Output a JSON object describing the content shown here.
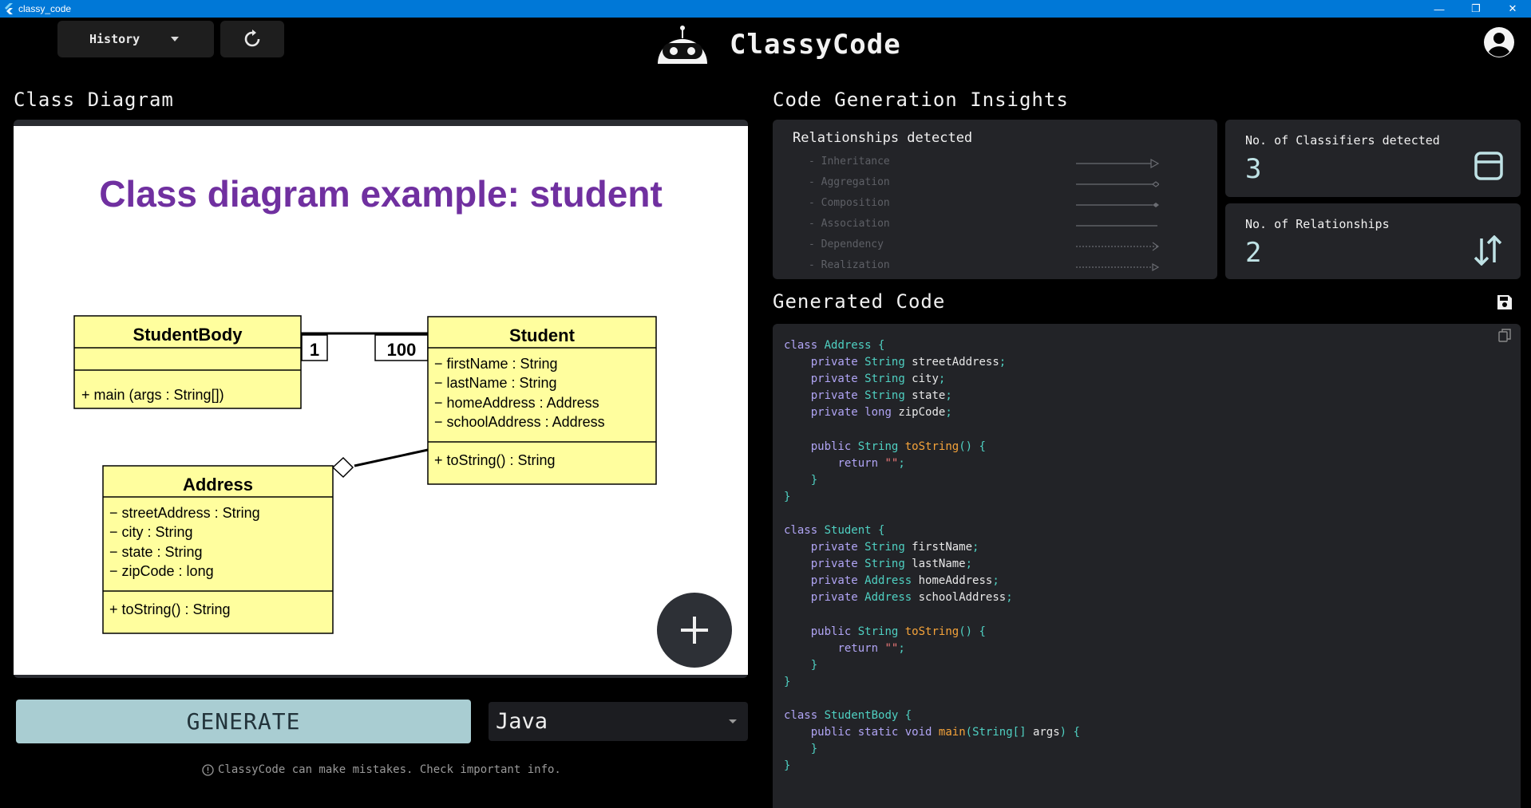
{
  "window": {
    "title": "classy_code"
  },
  "header": {
    "history_label": "History",
    "brand": "ClassyCode"
  },
  "diagram_section": {
    "title": "Class Diagram"
  },
  "diagram": {
    "heading": "Class diagram example: student",
    "classes": [
      {
        "name": "StudentBody",
        "attributes": [],
        "methods": [
          "+ main (args : String[])"
        ]
      },
      {
        "name": "Student",
        "attributes": [
          "− firstName : String",
          "− lastName : String",
          "− homeAddress : Address",
          "− schoolAddress : Address"
        ],
        "methods": [
          "+ toString() : String"
        ]
      },
      {
        "name": "Address",
        "attributes": [
          "− streetAddress : String",
          "− city : String",
          "− state : String",
          "− zipCode : long"
        ],
        "methods": [
          "+ toString() : String"
        ]
      }
    ],
    "multiplicities": [
      "1",
      "100"
    ]
  },
  "controls": {
    "generate_label": "GENERATE",
    "language": "Java",
    "disclaimer": "ClassyCode can make mistakes. Check important info."
  },
  "insights": {
    "title": "Code Generation Insights",
    "relationships_title": "Relationships detected",
    "relationship_types": [
      "- Inheritance",
      "- Aggregation",
      "- Composition",
      "- Association",
      "- Dependency",
      "- Realization"
    ],
    "classifiers_label": "No. of Classifiers detected",
    "classifiers_value": "3",
    "relationships_label": "No. of Relationships",
    "relationships_value": "2"
  },
  "generated_code": {
    "title": "Generated Code",
    "language": "Java",
    "lines": [
      "class Address {",
      "    private String streetAddress;",
      "    private String city;",
      "    private String state;",
      "    private long zipCode;",
      "",
      "    public String toString() {",
      "        return \"\";",
      "    }",
      "}",
      "",
      "class Student {",
      "    private String firstName;",
      "    private String lastName;",
      "    private Address homeAddress;",
      "    private Address schoolAddress;",
      "",
      "    public String toString() {",
      "        return \"\";",
      "    }",
      "}",
      "",
      "class StudentBody {",
      "    public static void main(String[] args) {",
      "    }",
      "}"
    ]
  }
}
